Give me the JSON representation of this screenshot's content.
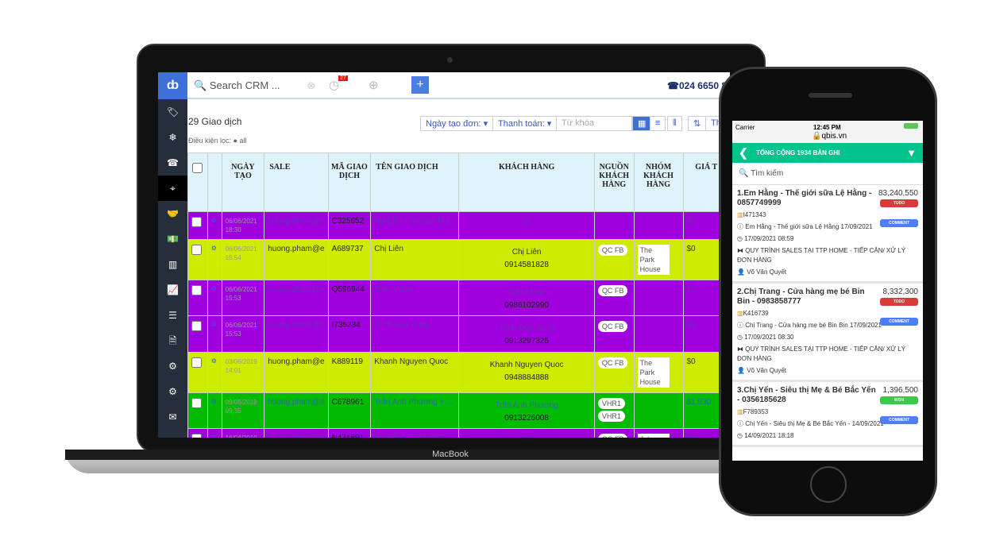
{
  "laptop": {
    "brand": "MacBook",
    "topbar": {
      "search_placeholder": "Search CRM ...",
      "notif_count": "27",
      "add_label": "+",
      "phone": "024 6650 89"
    },
    "sidebar": [
      "tag-icon",
      "snowflake-icon",
      "phone-icon",
      "crosshair-icon",
      "handshake-icon",
      "money-icon",
      "bar-chart-icon",
      "line-chart-icon",
      "list-icon",
      "document-icon",
      "gear-icon",
      "gears-icon",
      "mail-icon"
    ],
    "toolbar": {
      "count": "29 Giao dịch",
      "filter_label": "Điều kiện lọc:",
      "filter_value": "all",
      "date_filter": "Ngày tạo đơn:",
      "payment_filter": "Thanh toán:",
      "keyword_placeholder": "Từ khóa",
      "more": "Th"
    },
    "columns": [
      "NGÀY TẠO",
      "SALE",
      "MÃ GIAO DỊCH",
      "TÊN GIAO DỊCH",
      "KHÁCH HÀNG",
      "NGUỒN KHÁCH HÀNG",
      "NHÓM KHÁCH HÀNG",
      "GIÁ T"
    ],
    "rows": [
      {
        "color": "p",
        "date": "06/06/2021",
        "time": "18:30",
        "sale": "huong.pham@e",
        "code": "C325652",
        "name": "Nguyễn Thị Xuân Hư...",
        "customer": "",
        "phone": "",
        "folder": true,
        "source": [],
        "group": "",
        "price": "$0"
      },
      {
        "color": "y",
        "date": "06/06/2021",
        "time": "15:54",
        "sale": "huong.pham@e",
        "code": "A689737",
        "name": "Chị Liên",
        "customer": "Chị Liên",
        "phone": "0914581828",
        "source": [
          "QC FB"
        ],
        "group": "The Park House",
        "price": "$0"
      },
      {
        "color": "p",
        "date": "06/06/2021",
        "time": "15:53",
        "sale": "huong.pham@e",
        "code": "Q596944",
        "name": "Trần Mạnh",
        "customer": "Trần Mạnh",
        "phone": "0986102990",
        "source": [
          "QC FB"
        ],
        "group": "",
        "price": "$0"
      },
      {
        "color": "p",
        "date": "06/06/2021",
        "time": "15:53",
        "sale": "huong.pham@e",
        "code": "I735234",
        "name": "Trịnh Duy Hùng",
        "customer": "Trịnh Duy Hùng",
        "phone": "0913297325",
        "source": [
          "QC FB"
        ],
        "group": "",
        "price": "$0"
      },
      {
        "color": "y",
        "date": "03/06/2019",
        "time": "14:01",
        "sale": "huong.pham@e",
        "code": "K889119",
        "name": "Khanh Nguyen Quoc",
        "customer": "Khanh Nguyen Quoc",
        "phone": "0948884888",
        "source": [
          "QC FB"
        ],
        "group": "The Park House",
        "price": "$0"
      },
      {
        "color": "g",
        "date": "09/05/2019",
        "time": "09:35",
        "sale": "huong.pham@e",
        "code": "C678961",
        "name": "Trần Anh Phương + ...",
        "customer": "Trần Anh Phương",
        "phone": "0913226008",
        "source": [
          "VHR1",
          "VHR1"
        ],
        "group": "",
        "price": "$1,530"
      },
      {
        "color": "p",
        "date": "16/04/2019",
        "time": "14:21",
        "sale": "huong.pham@e",
        "code": "N471891",
        "name": "Nguyễn Thảo Linh 1",
        "customer": "",
        "phone": "",
        "folder": true,
        "source": [
          "QC FB"
        ],
        "group": "John and",
        "price": "$0"
      }
    ]
  },
  "phone": {
    "carrier": "Carrier",
    "time": "12:45 PM",
    "url": "qbis.vn",
    "header": "TỔNG CỘNG 1934 BẢN GHI",
    "search_placeholder": "Tìm kiếm",
    "cards": [
      {
        "title": "1.Em Hằng - Thế giới sữa Lệ Hằng - 0857749999",
        "amount": "83,240,550",
        "status": "TODO",
        "status_color": "#d93a3a",
        "comment": "COMMENT",
        "code": "I471343",
        "contact": "Em Hằng - Thế giới sữa Lệ Hằng 17/09/2021",
        "datetime": "17/09/2021 08:59",
        "process": "QUY TRÌNH SALES TẠI TTP HOME - TIẾP CẬN/ XỬ LÝ ĐƠN HÀNG",
        "owner": "Võ Văn Quyết"
      },
      {
        "title": "2.Chị Trang - Cửa hàng mẹ bé Bin Bin - 0983858777",
        "amount": "8,332,300",
        "status": "TODO",
        "status_color": "#d93a3a",
        "comment": "COMMENT",
        "code": "K416739",
        "contact": "Chị Trang - Cửa hàng mẹ bé Bin Bin 17/09/2021",
        "datetime": "17/09/2021 08:30",
        "process": "QUY TRÌNH SALES TẠI TTP HOME - TIẾP CẬN/ XỬ LÝ ĐƠN HÀNG",
        "owner": "Võ Văn Quyết"
      },
      {
        "title": "3.Chị Yến - Siêu thị Mẹ & Bé Bắc Yến - 0356185628",
        "amount": "1,396,500",
        "status": "WON",
        "status_color": "#3cc94a",
        "comment": "COMMENT",
        "code": "F789353",
        "contact": "Chị Yến - Siêu thị Mẹ & Bé Bắc Yến - 14/09/2021",
        "datetime": "14/09/2021 18:18",
        "process": "",
        "owner": ""
      }
    ]
  }
}
